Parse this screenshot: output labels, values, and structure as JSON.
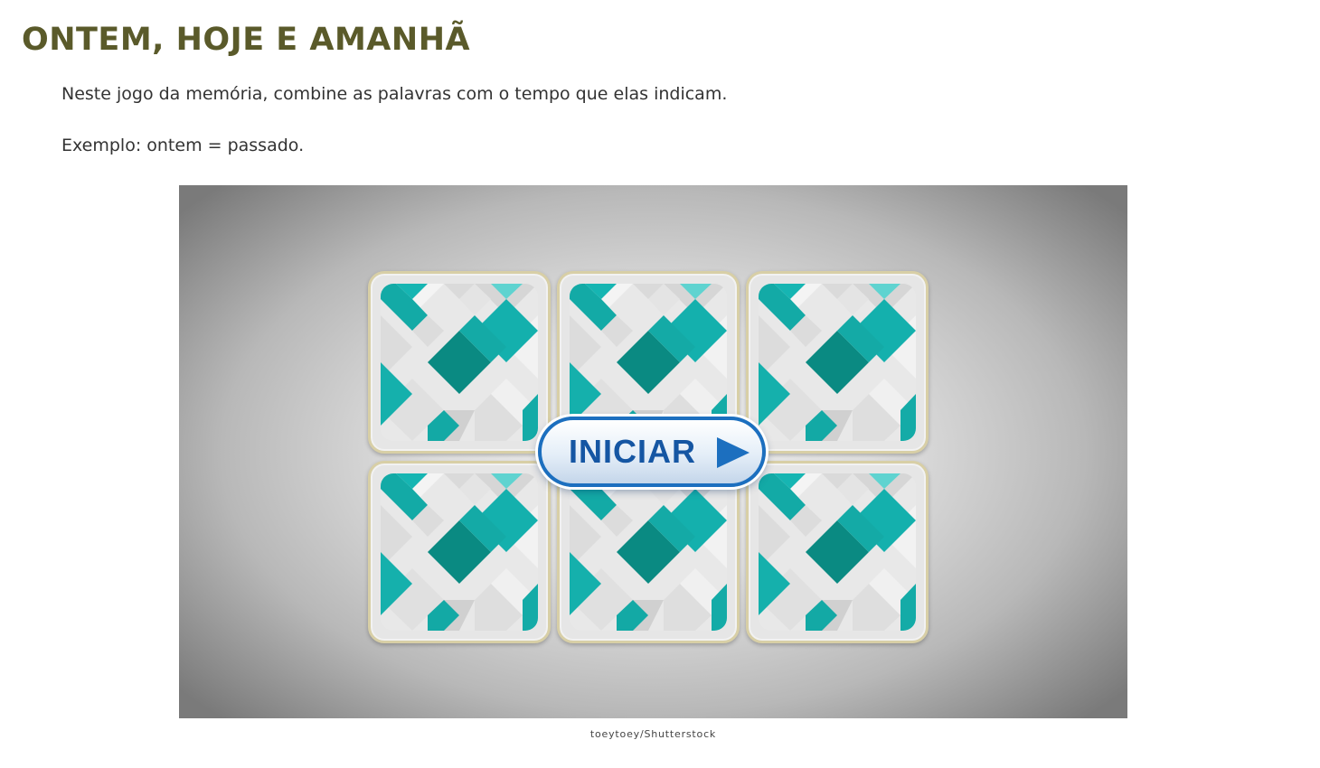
{
  "page": {
    "title": "ONTEM, HOJE E AMANHÃ",
    "instruction": "Neste jogo da memória, combine as palavras com o tempo que elas indicam.",
    "example": "Exemplo: ontem = passado."
  },
  "game": {
    "start_label": "INICIAR",
    "cards_face_down": 6,
    "card_pattern_colors": [
      "#17b3b0",
      "#0a8c84",
      "#cfcfcf",
      "#f0f0f0"
    ]
  },
  "credit": "toeytoey/Shutterstock",
  "colors": {
    "title": "#5a5a2a",
    "button_border": "#1c6fbf",
    "button_text": "#1556a3"
  }
}
